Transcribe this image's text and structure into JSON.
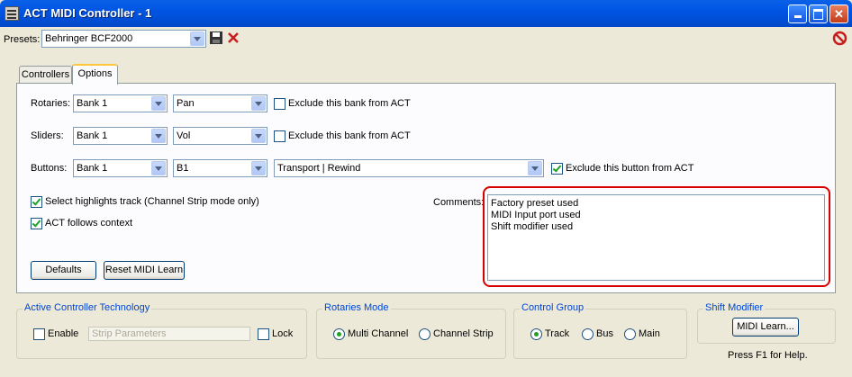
{
  "window": {
    "title": "ACT MIDI Controller - 1"
  },
  "presets": {
    "label": "Presets:",
    "value": "Behringer BCF2000"
  },
  "tabs": [
    {
      "label": "Controllers"
    },
    {
      "label": "Options"
    }
  ],
  "options": {
    "rotaries": {
      "label": "Rotaries:",
      "bank": "Bank 1",
      "param": "Pan",
      "exclude_label": "Exclude this bank from ACT"
    },
    "sliders": {
      "label": "Sliders:",
      "bank": "Bank 1",
      "param": "Vol",
      "exclude_label": "Exclude this bank from ACT"
    },
    "buttons": {
      "label": "Buttons:",
      "bank": "Bank 1",
      "button": "B1",
      "action": "Transport | Rewind",
      "exclude_label": "Exclude this button from ACT"
    },
    "select_highlights_label": "Select highlights track (Channel Strip mode only)",
    "act_follows_label": "ACT follows context",
    "comments_label": "Comments:",
    "comments": [
      "Factory preset used",
      "MIDI Input port used",
      "Shift modifier used"
    ],
    "defaults_label": "Defaults",
    "reset_label": "Reset MIDI Learn"
  },
  "act_group": {
    "title": "Active Controller Technology",
    "enable_label": "Enable",
    "placeholder": "Strip Parameters",
    "lock_label": "Lock"
  },
  "rotaries_mode": {
    "title": "Rotaries Mode",
    "multi_label": "Multi Channel",
    "strip_label": "Channel Strip"
  },
  "control_group": {
    "title": "Control Group",
    "track_label": "Track",
    "bus_label": "Bus",
    "main_label": "Main"
  },
  "shift_modifier": {
    "title": "Shift Modifier",
    "button_label": "MIDI Learn..."
  },
  "help_text": "Press F1 for Help.",
  "colors": {
    "titlebar": "#0054E3",
    "highlight": "#D90000",
    "group_title": "#0046D5"
  }
}
